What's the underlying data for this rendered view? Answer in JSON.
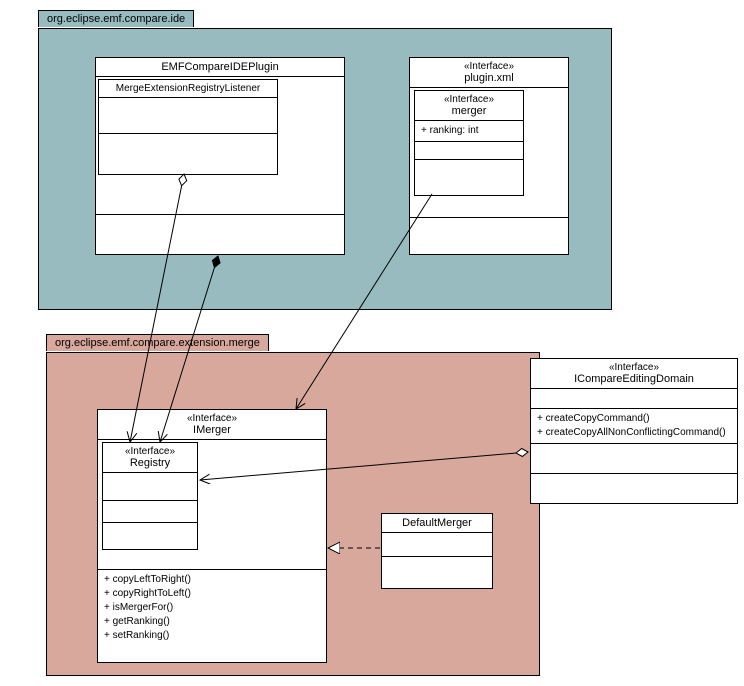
{
  "packages": {
    "ide": {
      "name": "org.eclipse.emf.compare.ide"
    },
    "merge": {
      "name": "org.eclipse.emf.compare.extension.merge"
    }
  },
  "classes": {
    "emfPlugin": {
      "name": "EMFCompareIDEPlugin",
      "inner": {
        "name": "MergeExtensionRegistryListener"
      }
    },
    "pluginXml": {
      "stereo": "«Interface»",
      "name": "plugin.xml",
      "inner": {
        "stereo": "«Interface»",
        "name": "merger",
        "attr": "+ ranking: int"
      }
    },
    "imerger": {
      "stereo": "«Interface»",
      "name": "IMerger",
      "inner": {
        "stereo": "«Interface»",
        "name": "Registry"
      },
      "ops": [
        "+ copyLeftToRight()",
        "+ copyRightToLeft()",
        "+ isMergerFor()",
        "+ getRanking()",
        "+ setRanking()"
      ]
    },
    "defaultMerger": {
      "name": "DefaultMerger"
    },
    "iced": {
      "stereo": "«Interface»",
      "name": "ICompareEditingDomain",
      "ops": [
        "+ createCopyCommand()",
        "+ createCopyAllNonConflictingCommand()"
      ]
    }
  }
}
